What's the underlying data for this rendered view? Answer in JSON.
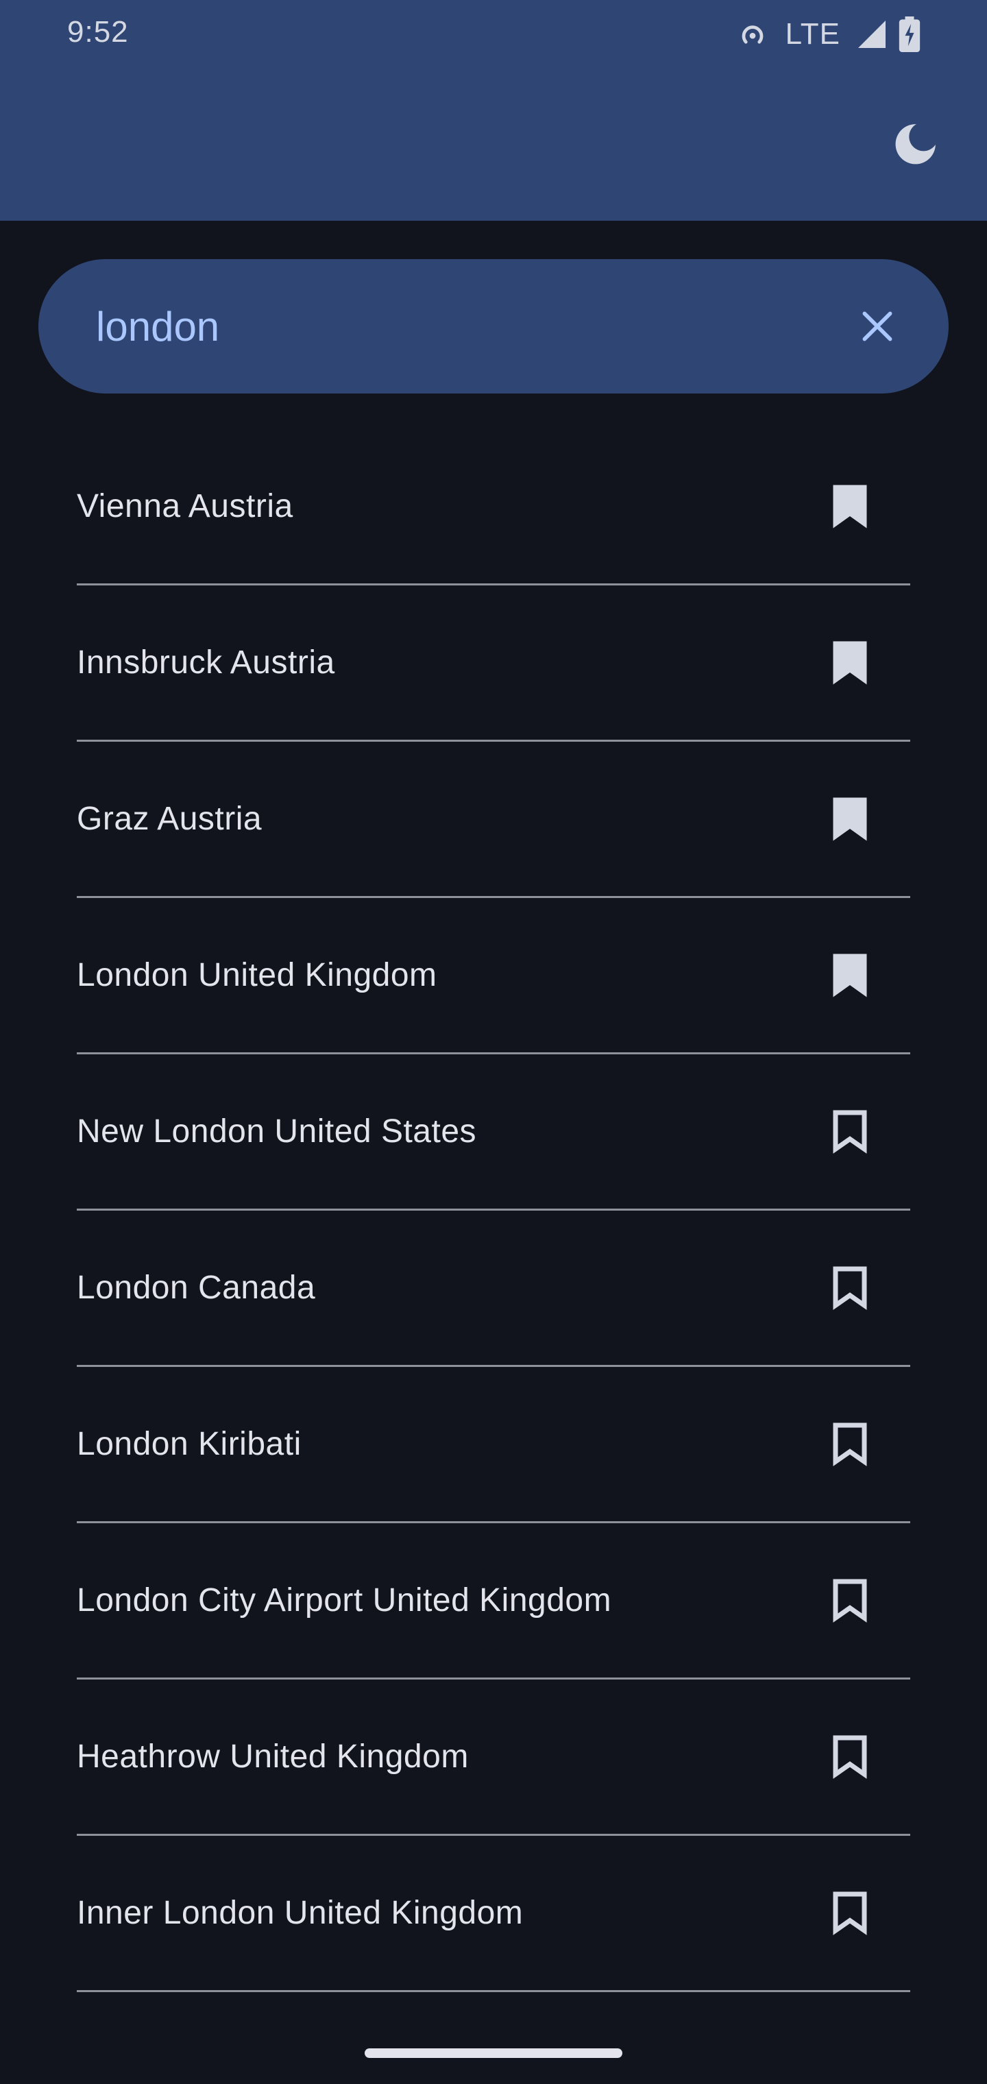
{
  "status_bar": {
    "time": "9:52",
    "network": "LTE",
    "icons": [
      "hotspot-icon",
      "signal-icon",
      "battery-charging-icon"
    ]
  },
  "app_bar": {
    "theme_toggle_icon": "moon-icon"
  },
  "search": {
    "value": "london",
    "clear_icon": "close-icon"
  },
  "results": [
    {
      "label": "Vienna Austria",
      "bookmarked": true
    },
    {
      "label": "Innsbruck Austria",
      "bookmarked": true
    },
    {
      "label": "Graz Austria",
      "bookmarked": true
    },
    {
      "label": "London United Kingdom",
      "bookmarked": true
    },
    {
      "label": "New London United States",
      "bookmarked": false
    },
    {
      "label": "London Canada",
      "bookmarked": false
    },
    {
      "label": "London Kiribati",
      "bookmarked": false
    },
    {
      "label": "London City Airport United Kingdom",
      "bookmarked": false
    },
    {
      "label": "Heathrow United Kingdom",
      "bookmarked": false
    },
    {
      "label": "Inner London United Kingdom",
      "bookmarked": false
    }
  ],
  "colors": {
    "app_bar": "#2f4573",
    "background": "#11141d",
    "search_text": "#aac7ff",
    "list_text": "#e3e4ec",
    "divider": "#8e909a",
    "icon": "#d4d8e2"
  }
}
